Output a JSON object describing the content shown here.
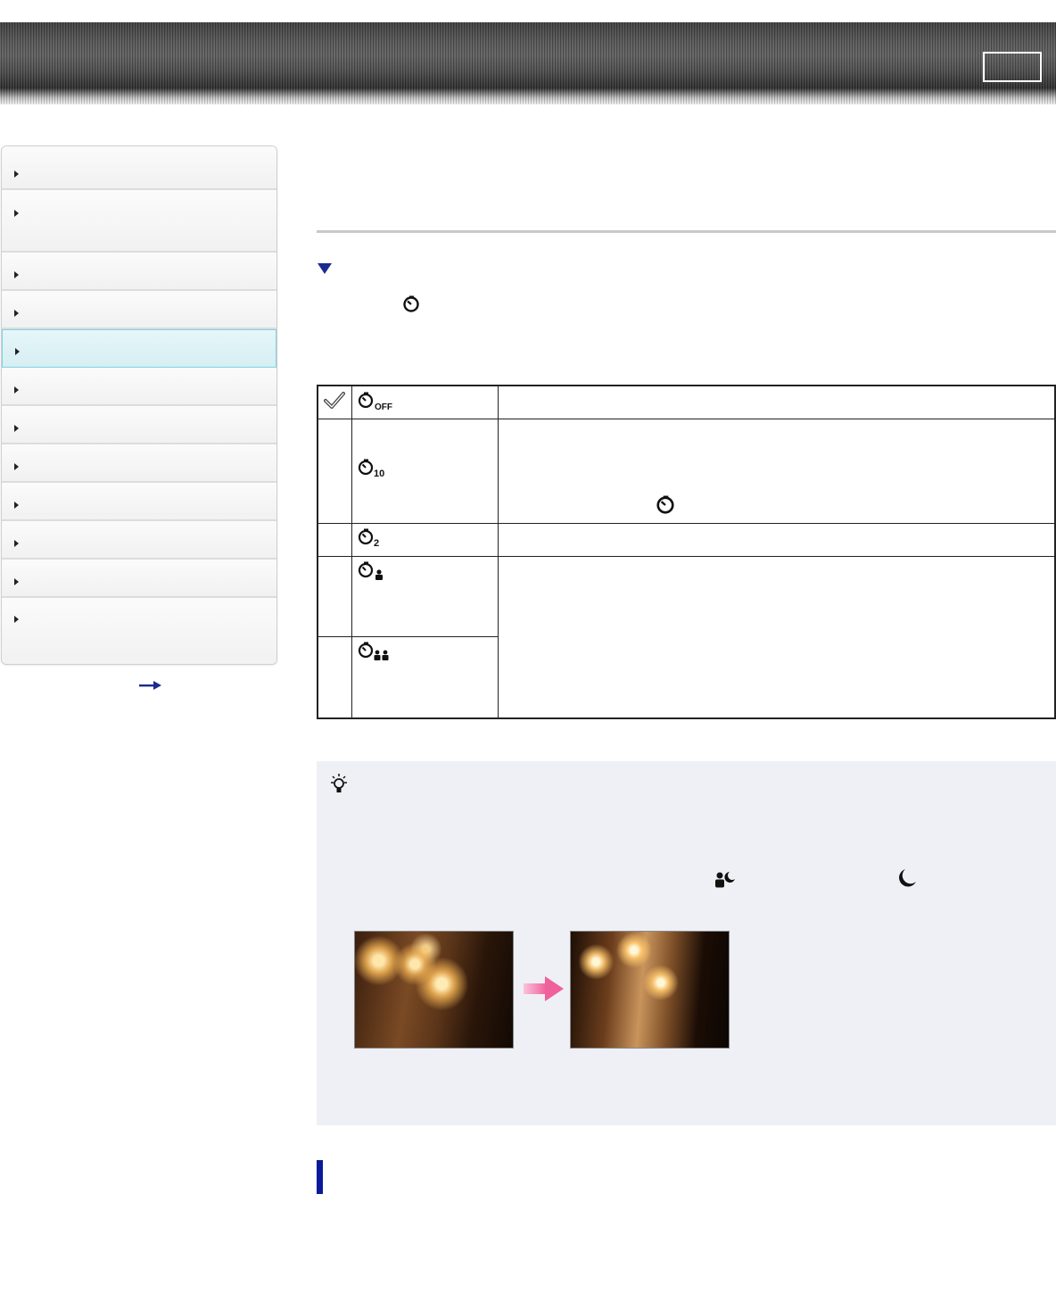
{
  "header": {
    "right_box_label": ""
  },
  "sidebar": {
    "items": [
      {
        "label": ""
      },
      {
        "label": ""
      },
      {
        "label": ""
      },
      {
        "label": ""
      },
      {
        "label": "",
        "active": true
      },
      {
        "label": ""
      },
      {
        "label": ""
      },
      {
        "label": ""
      },
      {
        "label": ""
      },
      {
        "label": ""
      },
      {
        "label": ""
      },
      {
        "label": ""
      }
    ],
    "more_icon": "right-arrow-icon"
  },
  "main": {
    "section_icon": "triangle-down-icon",
    "inline_icon": "self-timer-icon",
    "table": {
      "rows": [
        {
          "icon": "self-timer-off-icon",
          "selected": true,
          "description": ""
        },
        {
          "icon": "self-timer-10-icon",
          "selected": false,
          "description": ""
        },
        {
          "icon": "self-timer-2-icon",
          "selected": false,
          "description": ""
        },
        {
          "icon": "self-portrait-one-icon",
          "selected": false,
          "description": ""
        },
        {
          "icon": "self-portrait-two-icon",
          "selected": false,
          "description": ""
        }
      ]
    },
    "hint": {
      "icon": "lightbulb-icon",
      "scene_icons": [
        "night-portrait-icon",
        "night-scene-icon"
      ],
      "images": [
        "blurred-night-photo",
        "sharp-night-photo"
      ],
      "arrow_icon": "pink-right-arrow-icon"
    }
  },
  "colors": {
    "accent_blue": "#1a2b8f",
    "active_item": "#d6eef3",
    "hint_bg": "#eef0f5",
    "arrow_pink": "#f0609a"
  }
}
